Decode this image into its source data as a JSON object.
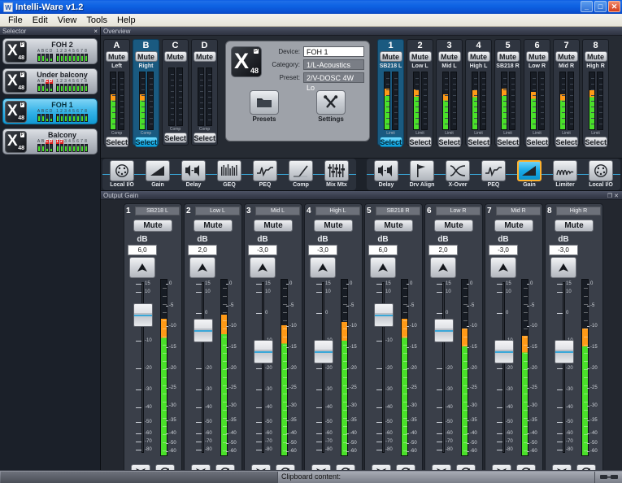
{
  "window": {
    "title": "Intelli-Ware v1.2",
    "icon": "window-logo-icon",
    "minimize": "_",
    "maximize": "□",
    "close": "✕"
  },
  "menu": [
    "File",
    "Edit",
    "View",
    "Tools",
    "Help"
  ],
  "selector": {
    "title": "Selector",
    "close": "×",
    "items": [
      {
        "name": "FOH 2",
        "active": false,
        "in_labels": [
          "A",
          "B",
          "C",
          "D"
        ],
        "in_red": [
          false,
          false,
          false,
          false
        ],
        "in_levels": [
          70,
          70,
          40,
          40
        ],
        "out_labels": [
          "1",
          "2",
          "3",
          "4",
          "5",
          "6",
          "7",
          "8"
        ],
        "out_red": [
          false,
          false,
          false,
          false,
          false,
          false,
          false,
          false
        ],
        "out_levels": [
          75,
          75,
          75,
          75,
          75,
          75,
          75,
          75
        ]
      },
      {
        "name": "Under balcony",
        "active": false,
        "in_labels": [
          "A",
          "B",
          "C",
          "D"
        ],
        "in_red": [
          false,
          false,
          true,
          true
        ],
        "in_levels": [
          70,
          70,
          40,
          40
        ],
        "out_labels": [
          "1",
          "2",
          "3",
          "4",
          "5",
          "6",
          "7",
          "8"
        ],
        "out_red": [
          false,
          false,
          false,
          false,
          false,
          false,
          false,
          false
        ],
        "out_levels": [
          75,
          75,
          75,
          75,
          75,
          75,
          75,
          75
        ]
      },
      {
        "name": "FOH 1",
        "active": true,
        "in_labels": [
          "A",
          "B",
          "C",
          "D"
        ],
        "in_red": [
          false,
          false,
          false,
          false
        ],
        "in_levels": [
          70,
          70,
          40,
          40
        ],
        "out_labels": [
          "1",
          "2",
          "3",
          "4",
          "5",
          "6",
          "7",
          "8"
        ],
        "out_red": [
          false,
          false,
          false,
          false,
          false,
          false,
          false,
          false
        ],
        "out_levels": [
          75,
          75,
          75,
          75,
          75,
          75,
          75,
          75
        ]
      },
      {
        "name": "Balcony",
        "active": false,
        "in_labels": [
          "A",
          "B",
          "C",
          "D"
        ],
        "in_red": [
          false,
          false,
          true,
          true
        ],
        "in_levels": [
          70,
          70,
          40,
          40
        ],
        "out_labels": [
          "1",
          "2",
          "3",
          "4",
          "5",
          "6",
          "7",
          "8"
        ],
        "out_red": [
          true,
          true,
          false,
          false,
          false,
          false,
          false,
          false
        ],
        "out_levels": [
          75,
          75,
          75,
          75,
          75,
          75,
          75,
          75
        ]
      }
    ]
  },
  "overview": {
    "title": "Overview",
    "inputs": [
      {
        "num": "A",
        "mute": "Mute",
        "label": "Left",
        "select": "Select",
        "select_on": false,
        "comp": "Comp",
        "level": 62,
        "peak": false
      },
      {
        "num": "B",
        "mute": "Mute",
        "label": "Right",
        "select": "Select",
        "select_on": true,
        "comp": "Comp",
        "level": 62,
        "peak": false
      },
      {
        "num": "C",
        "mute": "Mute",
        "label": "",
        "select": "Select",
        "select_on": false,
        "comp": "Comp",
        "level": 0,
        "peak": false
      },
      {
        "num": "D",
        "mute": "Mute",
        "label": "",
        "select": "Select",
        "select_on": false,
        "comp": "Comp",
        "level": 0,
        "peak": false
      }
    ],
    "device": {
      "fields": [
        {
          "key": "Device:",
          "value": "FOH 1",
          "white": true
        },
        {
          "key": "Category:",
          "value": "1/L-Acoustics",
          "white": false
        },
        {
          "key": "Preset:",
          "value": "2/V-DOSC 4W Lo",
          "white": false
        }
      ],
      "presets_label": "Presets",
      "settings_label": "Settings",
      "presets_icon": "folder-icon",
      "settings_icon": "tools-icon"
    },
    "outputs": [
      {
        "num": "1",
        "mute": "Mute",
        "label": "SB218 L",
        "select": "Select",
        "select_on": true,
        "limit": "Limit",
        "level": 72
      },
      {
        "num": "2",
        "mute": "Mute",
        "label": "Low L",
        "select": "Select",
        "select_on": false,
        "limit": "Limit",
        "level": 70
      },
      {
        "num": "3",
        "mute": "Mute",
        "label": "Mid L",
        "select": "Select",
        "select_on": false,
        "limit": "Limit",
        "level": 62
      },
      {
        "num": "4",
        "mute": "Mute",
        "label": "High L",
        "select": "Select",
        "select_on": false,
        "limit": "Limit",
        "level": 68
      },
      {
        "num": "5",
        "mute": "Mute",
        "label": "SB218 R",
        "select": "Select",
        "select_on": false,
        "limit": "Limit",
        "level": 72
      },
      {
        "num": "6",
        "mute": "Mute",
        "label": "Low R",
        "select": "Select",
        "select_on": false,
        "limit": "Limit",
        "level": 66
      },
      {
        "num": "7",
        "mute": "Mute",
        "label": "Mid R",
        "select": "Select",
        "select_on": false,
        "limit": "Limit",
        "level": 62
      },
      {
        "num": "8",
        "mute": "Mute",
        "label": "High R",
        "select": "Select",
        "select_on": false,
        "limit": "Limit",
        "level": 68
      }
    ]
  },
  "toolbar": {
    "input_chain": [
      {
        "label": "Local I/O",
        "icon": "connector-icon",
        "active": false
      },
      {
        "label": "Gain",
        "icon": "ramp-icon",
        "active": false
      },
      {
        "label": "Delay",
        "icon": "delay-icon",
        "active": false
      },
      {
        "label": "GEQ",
        "icon": "geq-icon",
        "active": false
      },
      {
        "label": "PEQ",
        "icon": "peq-icon",
        "active": false
      },
      {
        "label": "Comp",
        "icon": "comp-icon",
        "active": false
      },
      {
        "label": "Mix Mtx",
        "icon": "mixmatrix-icon",
        "active": false
      }
    ],
    "output_chain": [
      {
        "label": "Delay",
        "icon": "delay-icon",
        "active": false
      },
      {
        "label": "Drv Align",
        "icon": "drvalign-icon",
        "active": false
      },
      {
        "label": "X-Over",
        "icon": "xover-icon",
        "active": false
      },
      {
        "label": "PEQ",
        "icon": "peq-icon",
        "active": false
      },
      {
        "label": "Gain",
        "icon": "ramp-icon",
        "active": true
      },
      {
        "label": "Limiter",
        "icon": "limiter-icon",
        "active": false
      },
      {
        "label": "Local I/O",
        "icon": "connector-icon",
        "active": false
      }
    ]
  },
  "output_gain": {
    "title": "Output Gain",
    "restore": "❐",
    "close": "✕",
    "db_label": "dB",
    "up_icon": "up-arrow-icon",
    "down_icon": "down-arrow-icon",
    "phase_icon": "phase-invert-icon",
    "fader_scale": [
      "15",
      "10",
      "0",
      "-10",
      "-20",
      "-30",
      "-40",
      "-50",
      "-60",
      "-70",
      "-80"
    ],
    "meter_scale": [
      "0",
      "-5",
      "-10",
      "-15",
      "-20",
      "-25",
      "-30",
      "-35",
      "-40",
      "-50",
      "-60"
    ],
    "channels": [
      {
        "num": "1",
        "name": "SB218 L",
        "mute": "Mute",
        "db": "6,0",
        "fader_pct": 86,
        "meter": 78
      },
      {
        "num": "2",
        "name": "Low L",
        "mute": "Mute",
        "db": "2,0",
        "fader_pct": 76,
        "meter": 80
      },
      {
        "num": "3",
        "name": "Mid L",
        "mute": "Mute",
        "db": "-3,0",
        "fader_pct": 62,
        "meter": 74
      },
      {
        "num": "4",
        "name": "High L",
        "mute": "Mute",
        "db": "-3,0",
        "fader_pct": 62,
        "meter": 76
      },
      {
        "num": "5",
        "name": "SB218 R",
        "mute": "Mute",
        "db": "6,0",
        "fader_pct": 86,
        "meter": 78
      },
      {
        "num": "6",
        "name": "Low R",
        "mute": "Mute",
        "db": "2,0",
        "fader_pct": 76,
        "meter": 72
      },
      {
        "num": "7",
        "name": "Mid R",
        "mute": "Mute",
        "db": "-3,0",
        "fader_pct": 62,
        "meter": 68
      },
      {
        "num": "8",
        "name": "High R",
        "mute": "Mute",
        "db": "-3,0",
        "fader_pct": 62,
        "meter": 72
      }
    ]
  },
  "statusbar": {
    "clipboard_label": "Clipboard content:",
    "network_icon": "network-icon"
  },
  "colors": {
    "accent_blue": "#19a9e6",
    "meter_green": "#4ae02a",
    "meter_orange": "#ff9a17",
    "alert_red": "#e02020",
    "title_blue": "#0a5ae0"
  }
}
